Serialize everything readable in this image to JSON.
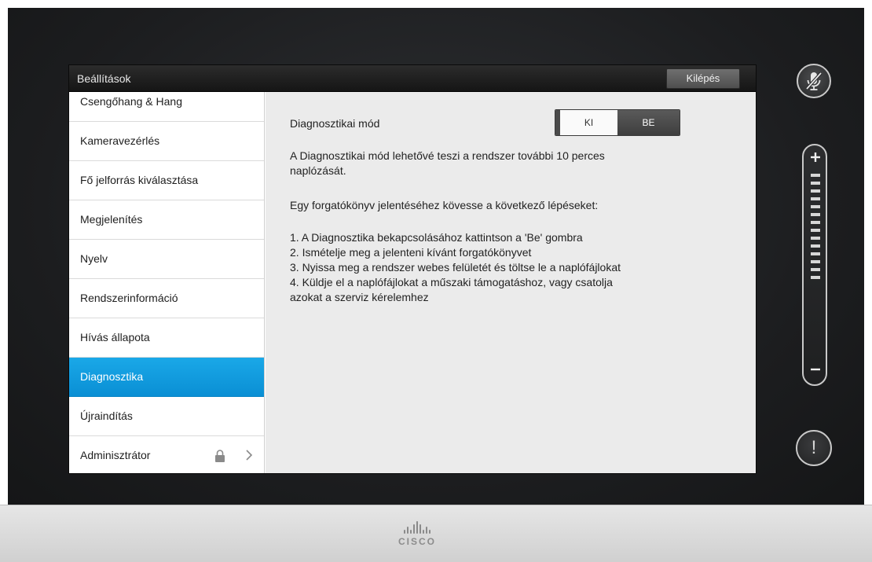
{
  "header": {
    "title": "Beállítások",
    "exit_label": "Kilépés"
  },
  "sidebar": {
    "items": [
      {
        "label": "Csengőhang & Hang"
      },
      {
        "label": "Kameravezérlés"
      },
      {
        "label": "Fő jelforrás kiválasztása"
      },
      {
        "label": "Megjelenítés"
      },
      {
        "label": "Nyelv"
      },
      {
        "label": "Rendszerinformáció"
      },
      {
        "label": "Hívás állapota"
      },
      {
        "label": "Diagnosztika"
      },
      {
        "label": "Újraindítás"
      },
      {
        "label": "Adminisztrátor"
      }
    ],
    "active_item": "Diagnosztika"
  },
  "content": {
    "mode_label": "Diagnosztikai mód",
    "toggle_off": "KI",
    "toggle_on": "BE",
    "toggle_state": "KI",
    "desc_line1": "A Diagnosztikai mód lehetővé teszi a rendszer további 10 perces",
    "desc_line2": "naplózását.",
    "steps_intro": "Egy forgatókönyv jelentéséhez kövesse a következő lépéseket:",
    "step1": "1. A Diagnosztika bekapcsolásához kattintson a 'Be' gombra",
    "step2": "2. Ismételje meg a jelenteni kívánt forgatókönyvet",
    "step3": "3. Nyissa meg a rendszer webes felületét és töltse le a naplófájlokat",
    "step4a": "4. Küldje el a naplófájlokat a műszaki támogatáshoz, vagy csatolja",
    "step4b": "azokat a szerviz kérelemhez"
  },
  "side_controls": {
    "mute_icon": "microphone-muted-icon",
    "volume_plus": "plus-icon",
    "volume_minus": "minus-icon",
    "volume_levels": 14,
    "alert_icon": "exclamation-icon",
    "alert_symbol": "!"
  },
  "footer": {
    "brand": "CISCO"
  },
  "colors": {
    "accent": "#0e9ad9",
    "background": "#1e1f21",
    "content_bg": "#ebebeb"
  }
}
